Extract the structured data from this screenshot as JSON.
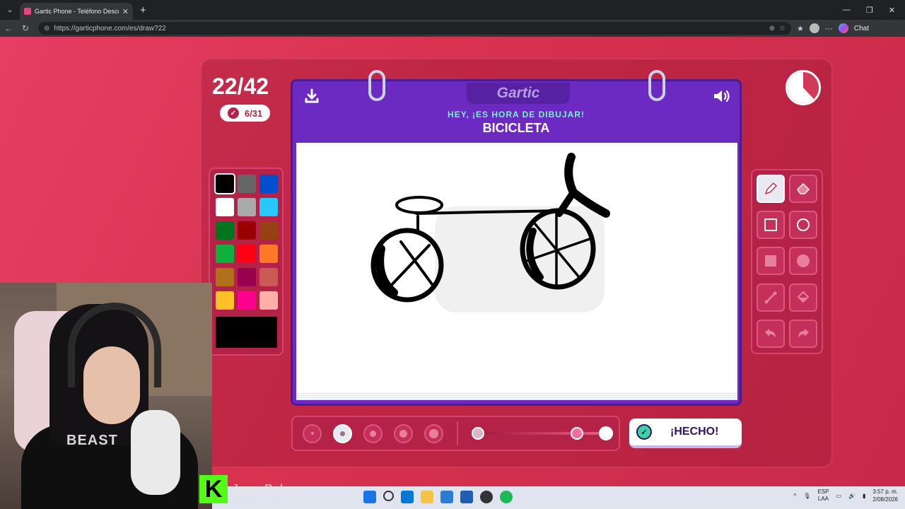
{
  "browser": {
    "tab_title": "Gartic Phone - Teléfono Descomp",
    "tab_close": "✕",
    "new_tab": "+",
    "url": "https://garticphone.com/es/draw?22",
    "chat_label": "Chat",
    "window_controls": [
      "—",
      "❐",
      "✕"
    ]
  },
  "game": {
    "round_counter": "22/42",
    "votes": "6/31",
    "logo": "Gartic",
    "prompt_line1": "HEY, ¡ES HORA DE DIBUJAR!",
    "prompt_word": "BICICLETA",
    "done_label": "¡HECHO!",
    "timer_elapsed_fraction": 0.62
  },
  "palette": {
    "colors": [
      "#000000",
      "#666666",
      "#0050cd",
      "#ffffff",
      "#aaaaaa",
      "#26c9ff",
      "#017420",
      "#990000",
      "#964112",
      "#11b03c",
      "#ff0013",
      "#ff7829",
      "#b0701c",
      "#99004e",
      "#cb5a57",
      "#ffc126",
      "#ff008f",
      "#feafa8"
    ],
    "selected_index": 0,
    "current_color": "#000000"
  },
  "tools": [
    "pencil-icon",
    "eraser-icon",
    "square-outline-icon",
    "circle-outline-icon",
    "square-fill-icon",
    "circle-fill-icon",
    "line-icon",
    "bucket-icon",
    "undo-icon",
    "redo-icon"
  ],
  "brush_sizes": {
    "count": 5,
    "selected_index": 1
  },
  "opacity": {
    "value": 0.9
  },
  "webcam": {
    "shirt_text": "BEAST"
  },
  "streamer": {
    "name": "JessyBaby",
    "platform_logo": "K"
  },
  "taskbar": {
    "lang_top": "ESP",
    "lang_bottom": "LAA",
    "time": "3:57 p. m.",
    "date": "2/08/2026"
  }
}
